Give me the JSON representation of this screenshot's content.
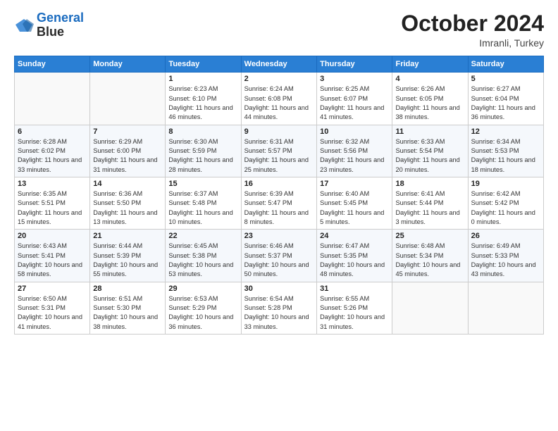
{
  "header": {
    "logo_line1": "General",
    "logo_line2": "Blue",
    "month": "October 2024",
    "location": "Imranli, Turkey"
  },
  "weekdays": [
    "Sunday",
    "Monday",
    "Tuesday",
    "Wednesday",
    "Thursday",
    "Friday",
    "Saturday"
  ],
  "weeks": [
    [
      {
        "day": "",
        "info": ""
      },
      {
        "day": "",
        "info": ""
      },
      {
        "day": "1",
        "info": "Sunrise: 6:23 AM\nSunset: 6:10 PM\nDaylight: 11 hours and 46 minutes."
      },
      {
        "day": "2",
        "info": "Sunrise: 6:24 AM\nSunset: 6:08 PM\nDaylight: 11 hours and 44 minutes."
      },
      {
        "day": "3",
        "info": "Sunrise: 6:25 AM\nSunset: 6:07 PM\nDaylight: 11 hours and 41 minutes."
      },
      {
        "day": "4",
        "info": "Sunrise: 6:26 AM\nSunset: 6:05 PM\nDaylight: 11 hours and 38 minutes."
      },
      {
        "day": "5",
        "info": "Sunrise: 6:27 AM\nSunset: 6:04 PM\nDaylight: 11 hours and 36 minutes."
      }
    ],
    [
      {
        "day": "6",
        "info": "Sunrise: 6:28 AM\nSunset: 6:02 PM\nDaylight: 11 hours and 33 minutes."
      },
      {
        "day": "7",
        "info": "Sunrise: 6:29 AM\nSunset: 6:00 PM\nDaylight: 11 hours and 31 minutes."
      },
      {
        "day": "8",
        "info": "Sunrise: 6:30 AM\nSunset: 5:59 PM\nDaylight: 11 hours and 28 minutes."
      },
      {
        "day": "9",
        "info": "Sunrise: 6:31 AM\nSunset: 5:57 PM\nDaylight: 11 hours and 25 minutes."
      },
      {
        "day": "10",
        "info": "Sunrise: 6:32 AM\nSunset: 5:56 PM\nDaylight: 11 hours and 23 minutes."
      },
      {
        "day": "11",
        "info": "Sunrise: 6:33 AM\nSunset: 5:54 PM\nDaylight: 11 hours and 20 minutes."
      },
      {
        "day": "12",
        "info": "Sunrise: 6:34 AM\nSunset: 5:53 PM\nDaylight: 11 hours and 18 minutes."
      }
    ],
    [
      {
        "day": "13",
        "info": "Sunrise: 6:35 AM\nSunset: 5:51 PM\nDaylight: 11 hours and 15 minutes."
      },
      {
        "day": "14",
        "info": "Sunrise: 6:36 AM\nSunset: 5:50 PM\nDaylight: 11 hours and 13 minutes."
      },
      {
        "day": "15",
        "info": "Sunrise: 6:37 AM\nSunset: 5:48 PM\nDaylight: 11 hours and 10 minutes."
      },
      {
        "day": "16",
        "info": "Sunrise: 6:39 AM\nSunset: 5:47 PM\nDaylight: 11 hours and 8 minutes."
      },
      {
        "day": "17",
        "info": "Sunrise: 6:40 AM\nSunset: 5:45 PM\nDaylight: 11 hours and 5 minutes."
      },
      {
        "day": "18",
        "info": "Sunrise: 6:41 AM\nSunset: 5:44 PM\nDaylight: 11 hours and 3 minutes."
      },
      {
        "day": "19",
        "info": "Sunrise: 6:42 AM\nSunset: 5:42 PM\nDaylight: 11 hours and 0 minutes."
      }
    ],
    [
      {
        "day": "20",
        "info": "Sunrise: 6:43 AM\nSunset: 5:41 PM\nDaylight: 10 hours and 58 minutes."
      },
      {
        "day": "21",
        "info": "Sunrise: 6:44 AM\nSunset: 5:39 PM\nDaylight: 10 hours and 55 minutes."
      },
      {
        "day": "22",
        "info": "Sunrise: 6:45 AM\nSunset: 5:38 PM\nDaylight: 10 hours and 53 minutes."
      },
      {
        "day": "23",
        "info": "Sunrise: 6:46 AM\nSunset: 5:37 PM\nDaylight: 10 hours and 50 minutes."
      },
      {
        "day": "24",
        "info": "Sunrise: 6:47 AM\nSunset: 5:35 PM\nDaylight: 10 hours and 48 minutes."
      },
      {
        "day": "25",
        "info": "Sunrise: 6:48 AM\nSunset: 5:34 PM\nDaylight: 10 hours and 45 minutes."
      },
      {
        "day": "26",
        "info": "Sunrise: 6:49 AM\nSunset: 5:33 PM\nDaylight: 10 hours and 43 minutes."
      }
    ],
    [
      {
        "day": "27",
        "info": "Sunrise: 6:50 AM\nSunset: 5:31 PM\nDaylight: 10 hours and 41 minutes."
      },
      {
        "day": "28",
        "info": "Sunrise: 6:51 AM\nSunset: 5:30 PM\nDaylight: 10 hours and 38 minutes."
      },
      {
        "day": "29",
        "info": "Sunrise: 6:53 AM\nSunset: 5:29 PM\nDaylight: 10 hours and 36 minutes."
      },
      {
        "day": "30",
        "info": "Sunrise: 6:54 AM\nSunset: 5:28 PM\nDaylight: 10 hours and 33 minutes."
      },
      {
        "day": "31",
        "info": "Sunrise: 6:55 AM\nSunset: 5:26 PM\nDaylight: 10 hours and 31 minutes."
      },
      {
        "day": "",
        "info": ""
      },
      {
        "day": "",
        "info": ""
      }
    ]
  ]
}
